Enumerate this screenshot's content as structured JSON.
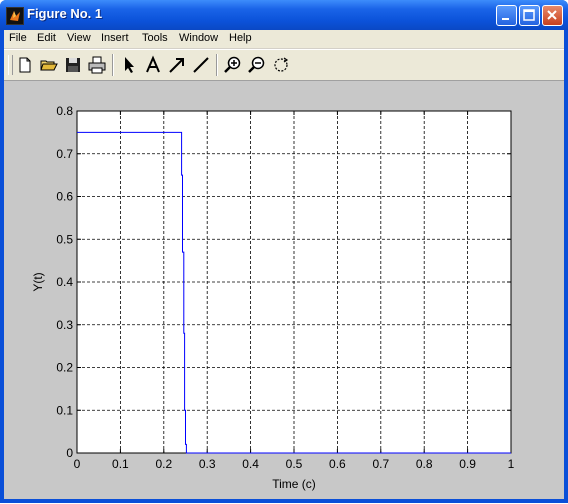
{
  "window": {
    "title": "Figure No. 1",
    "buttons": [
      "minimize",
      "maximize",
      "close"
    ]
  },
  "menubar": {
    "items": [
      "File",
      "Edit",
      "View",
      "Insert",
      "Tools",
      "Window",
      "Help"
    ]
  },
  "toolbar": {
    "tools": [
      "new-file-icon",
      "open-folder-icon",
      "save-icon",
      "print-icon",
      "select-arrow-icon",
      "text-insert-icon",
      "arrow-insert-icon",
      "line-insert-icon",
      "zoom-in-icon",
      "zoom-out-icon",
      "rotate-icon"
    ]
  },
  "colors": {
    "line": "#0000ff",
    "figure_background": "#c8c8c8",
    "title_bar": "#0a4fd8"
  },
  "chart_data": {
    "type": "line",
    "title": "",
    "xlabel": "Time (c)",
    "ylabel": "Y(t)",
    "xlim": [
      0,
      1
    ],
    "ylim": [
      0,
      0.8
    ],
    "x_ticks": [
      "0",
      "0.1",
      "0.2",
      "0.3",
      "0.4",
      "0.5",
      "0.6",
      "0.7",
      "0.8",
      "0.9",
      "1"
    ],
    "y_ticks": [
      "0",
      "0.1",
      "0.2",
      "0.3",
      "0.4",
      "0.5",
      "0.6",
      "0.7",
      "0.8"
    ],
    "grid": true,
    "series": [
      {
        "x": [
          0,
          0.241,
          0.241,
          0.243,
          0.243,
          0.246,
          0.246,
          0.248,
          0.248,
          0.25,
          0.25,
          0.252,
          0.252,
          1
        ],
        "y": [
          0.75,
          0.75,
          0.65,
          0.65,
          0.47,
          0.47,
          0.28,
          0.28,
          0.1,
          0.1,
          0.02,
          0.02,
          0,
          0
        ]
      }
    ]
  }
}
